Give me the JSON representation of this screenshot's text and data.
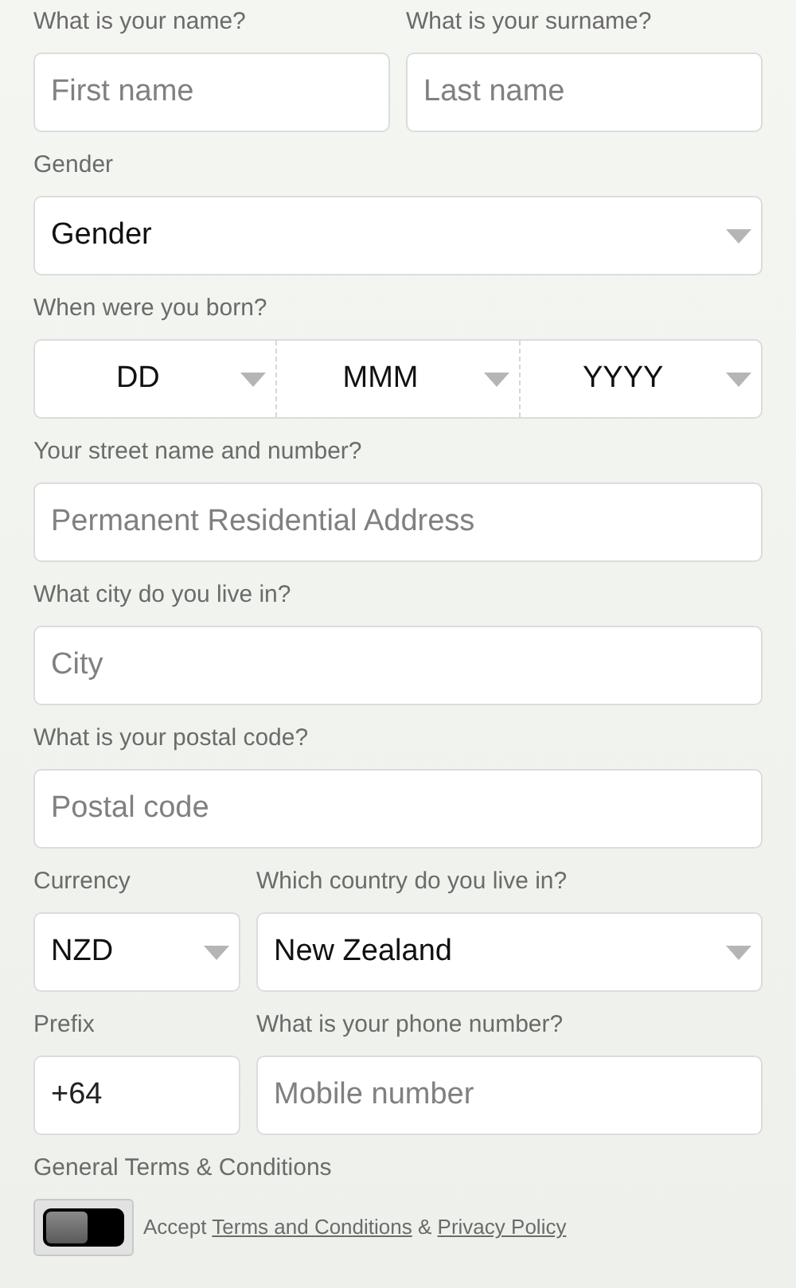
{
  "rows": [
    {
      "kind": "split",
      "fields": [
        {
          "kind": "text",
          "label": "What is your name?",
          "placeholder": "First name"
        },
        {
          "kind": "text",
          "label": "What is your surname?",
          "placeholder": "Last name"
        }
      ]
    },
    {
      "kind": "single",
      "fields": [
        {
          "kind": "select",
          "label": "Gender",
          "value": "Gender"
        }
      ]
    },
    {
      "kind": "single",
      "fields": [
        {
          "kind": "date",
          "label": "When were you born?",
          "parts": [
            "DD",
            "MMM",
            "YYYY"
          ]
        }
      ]
    },
    {
      "kind": "single",
      "fields": [
        {
          "kind": "text",
          "label": "Your street name and number?",
          "placeholder": "Permanent Residential Address"
        }
      ]
    },
    {
      "kind": "single",
      "fields": [
        {
          "kind": "text",
          "label": "What city do you live in?",
          "placeholder": "City"
        }
      ]
    },
    {
      "kind": "single",
      "fields": [
        {
          "kind": "text",
          "label": "What is your postal code?",
          "placeholder": "Postal code"
        }
      ]
    },
    {
      "kind": "lead",
      "fields": [
        {
          "kind": "select",
          "label": "Currency",
          "value": "NZD"
        },
        {
          "kind": "select",
          "label": "Which country do you live in?",
          "value": "New Zealand"
        }
      ]
    },
    {
      "kind": "lead",
      "fields": [
        {
          "kind": "text",
          "label": "Prefix",
          "value": "+64"
        },
        {
          "kind": "text",
          "label": "What is your phone number?",
          "placeholder": "Mobile number"
        }
      ]
    }
  ],
  "terms": {
    "label": "General Terms & Conditions",
    "on": false,
    "prefix": "Accept",
    "link_1": "Terms and Conditions",
    "joiner": "&",
    "link_2": "Privacy Policy"
  }
}
